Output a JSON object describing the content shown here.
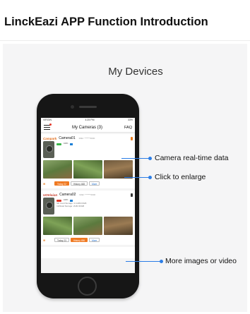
{
  "header": {
    "title": "LinckEazi APP Function Introduction"
  },
  "section": {
    "title": "My Devices"
  },
  "phone_screen": {
    "status_left": "VIRGIN",
    "status_time": "4:25 PM",
    "status_right": "33%",
    "nav_title": "My Cameras (3)",
    "nav_faq": "FAQ",
    "cameras": [
      {
        "brand": "Campark",
        "name": "Camera01",
        "id": "IMEI: *******0000",
        "battery": "100%",
        "today": "Today 22",
        "history": "History 468",
        "more": "More"
      },
      {
        "brand": "UOVision",
        "name": "Camera02",
        "id": "IMEI: *******0000",
        "battery": "100%",
        "sd": "SD Card Storage: 2.1GB/3.6GB",
        "internal": "In/Distal Storage: 2GB /20GB",
        "today": "Today 23",
        "history": "History 496",
        "more": "More"
      }
    ]
  },
  "callouts": [
    {
      "text": "Camera real-time data"
    },
    {
      "text": "Click to enlarge"
    },
    {
      "text": "More images or video"
    }
  ],
  "colors": {
    "accent": "#f07a22",
    "callout": "#2b7de6"
  }
}
